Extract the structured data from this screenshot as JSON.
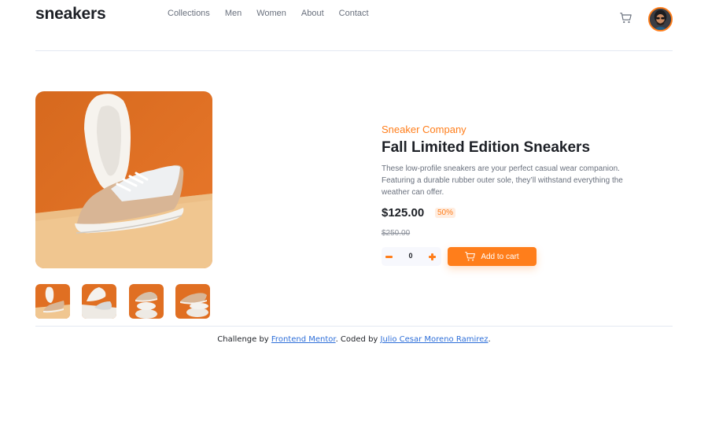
{
  "header": {
    "logo": "sneakers",
    "nav": [
      "Collections",
      "Men",
      "Women",
      "About",
      "Contact"
    ],
    "cart_icon": "cart-icon",
    "avatar_icon": "avatar"
  },
  "gallery": {
    "main_image": "shoe-photo",
    "thumbnails": [
      "thumbnail-1",
      "thumbnail-2",
      "thumbnail-3",
      "thumbnail-4"
    ]
  },
  "product": {
    "company": "Sneaker Company",
    "title": "Fall Limited Edition Sneakers",
    "description": "These low-profile sneakers are your perfect casual wear companion. Featuring a durable rubber outer sole, they’ll withstand everything the weather can offer.",
    "price": "$125.00",
    "discount": "50%",
    "old_price": "$250.00",
    "quantity": "0",
    "add_to_cart": "Add to cart"
  },
  "footer": {
    "prefix": "Challenge by ",
    "link1": "Frontend Mentor",
    "middle": ". Coded by ",
    "link2": "Julio Cesar Moreno Ramirez",
    "suffix": "."
  },
  "colors": {
    "accent": "#ff7e1b",
    "dark": "#1d2026",
    "gray": "#69707d",
    "link": "#2e6fd9"
  }
}
